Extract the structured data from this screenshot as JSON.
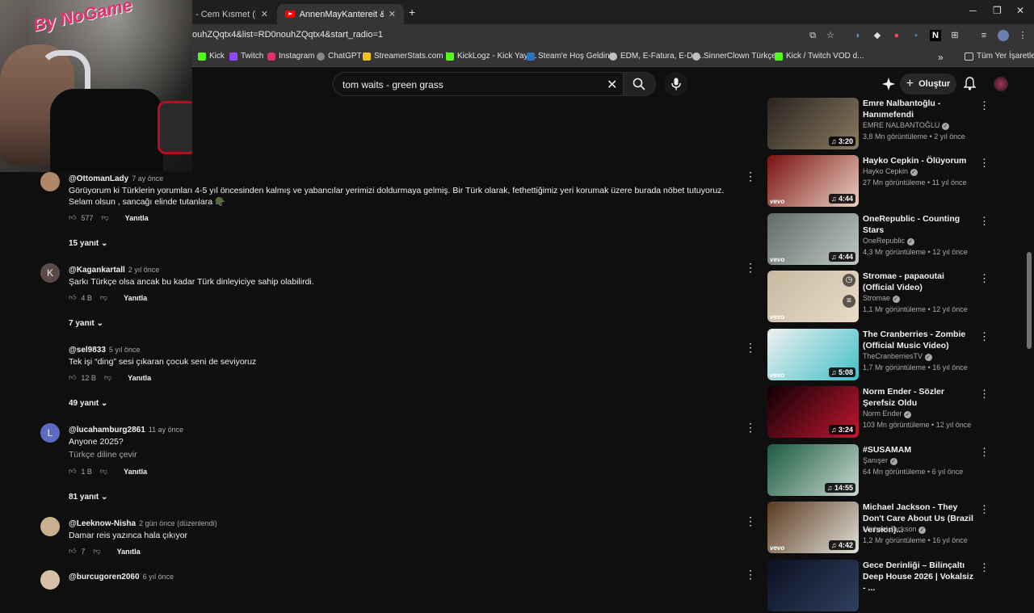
{
  "browser": {
    "tabs": [
      {
        "label": "- Cem Kısmet (Pilli Bebek)"
      },
      {
        "label": "AnnenMayKantereit & K.I.Z. - H"
      }
    ],
    "new_tab": "+",
    "url": "ouhZQqtx4&list=RD0nouhZQqtx4&start_radio=1",
    "bookmarks": [
      "Kick",
      "Twitch",
      "Instagram",
      "ChatGPT",
      "StreamerStats.com |...",
      "KickLogz - Kick Yayı...",
      "Steam'e Hoş Geldiniz",
      "EDM, E-Fatura, E-De...",
      "SinnerClown Türkçe...",
      "Kick / Twitch VOD d..."
    ],
    "bookmarks_more": "»",
    "all_bookmarks": "Tüm Yer İşaretleri",
    "overlay_text": "By NoGame"
  },
  "header": {
    "search_value": "tom waits - green grass",
    "create_label": "Oluştur"
  },
  "comments": [
    {
      "handle": "@OttomanLady",
      "time": "7 ay önce",
      "text": "Görüyorum ki Türklerin yorumları 4-5 yıl öncesinden kalmış ve yabancılar yerimizi doldurmaya gelmiş. Bir Türk olarak, fethettiğimiz yeri korumak üzere burada nöbet tutuyoruz. Selam olsun , sancağı elinde tutanlara 🪖",
      "likes": "577",
      "reply": "Yanıtla",
      "replies": "15 yanıt",
      "avatar_color": "#b08868",
      "avatar_letter": ""
    },
    {
      "handle": "@Kagankartall",
      "time": "2 yıl önce",
      "text": "Şarkı Türkçe olsa ancak bu kadar Türk dinleyiciye sahip olabilirdi.",
      "likes": "4 B",
      "reply": "Yanıtla",
      "replies": "7 yanıt",
      "avatar_color": "#5b4a47",
      "avatar_letter": "K"
    },
    {
      "handle": "@sel9833",
      "time": "5 yıl önce",
      "text": "Tek işi “ding” sesi çıkaran çocuk seni de seviyoruz",
      "likes": "12 B",
      "reply": "Yanıtla",
      "replies": "49 yanıt",
      "avatar_color": "#0f0f0f",
      "avatar_letter": ""
    },
    {
      "handle": "@lucahamburg2861",
      "time": "11 ay önce",
      "text": "Anyone 2025?",
      "translate": "Türkçe diline çevir",
      "likes": "1 B",
      "reply": "Yanıtla",
      "replies": "81 yanıt",
      "avatar_color": "#5c6bc0",
      "avatar_letter": "L"
    },
    {
      "handle": "@Leeknow-Nisha",
      "time": "2 gün önce (düzenlendi)",
      "text": "Damar reis yazınca hala çıkıyor",
      "likes": "7",
      "reply": "Yanıtla",
      "avatar_color": "#c8b090",
      "avatar_letter": ""
    },
    {
      "handle": "@burcugoren2060",
      "time": "6 yıl önce",
      "avatar_color": "#d8c0a8",
      "avatar_letter": ""
    }
  ],
  "sidebar": [
    {
      "title": "Emre Nalbantoğlu - Hanımefendi",
      "channel": "EMRE NALBANTOĞLU",
      "stats": "3,8 Mn görüntüleme • 2 yıl önce",
      "duration": "3:20",
      "vevo": "",
      "c1": "#2a2420",
      "c2": "#8a7a60"
    },
    {
      "title": "Hayko Cepkin - Ölüyorum",
      "channel": "Hayko Cepkin",
      "stats": "27 Mn görüntüleme • 11 yıl önce",
      "duration": "4:44",
      "vevo": "vevo",
      "c1": "#7a1010",
      "c2": "#e8d0c0"
    },
    {
      "title": "OneRepublic - Counting Stars",
      "channel": "OneRepublic",
      "stats": "4,3 Mr görüntüleme • 12 yıl önce",
      "duration": "4:44",
      "vevo": "vevo",
      "c1": "#606a66",
      "c2": "#c0c8c4"
    },
    {
      "title": "Stromae - papaoutai (Official Video)",
      "channel": "Stromae",
      "stats": "1,1 Mr görüntüleme • 12 yıl önce",
      "duration": "",
      "vevo": "vevo",
      "c1": "#c8b8a0",
      "c2": "#e8dcc8"
    },
    {
      "title": "The Cranberries - Zombie (Official Music Video)",
      "channel": "TheCranberriesTV",
      "stats": "1,7 Mr görüntüleme • 16 yıl önce",
      "duration": "5:08",
      "vevo": "vevo",
      "c1": "#f0f0f0",
      "c2": "#40c0c8"
    },
    {
      "title": "Norm Ender - Sözler Şerefsiz Oldu",
      "channel": "Norm Ender",
      "stats": "103 Mn görüntüleme • 12 yıl önce",
      "duration": "3:24",
      "vevo": "",
      "c1": "#100004",
      "c2": "#c01830"
    },
    {
      "title": "#SUSAMAM",
      "channel": "Şanışer",
      "stats": "64 Mn görüntüleme • 6 yıl önce",
      "duration": "14:55",
      "vevo": "",
      "c1": "#1a5a40",
      "c2": "#c8d8d0"
    },
    {
      "title": "Michael Jackson - They Don't Care About Us (Brazil Version)...",
      "channel": "Michael Jackson",
      "stats": "1,2 Mr görüntüleme • 16 yıl önce",
      "duration": "4:42",
      "vevo": "vevo",
      "c1": "#5a3a20",
      "c2": "#e0e0d8"
    },
    {
      "title": "Gece Derinliği – Bilinçaltı Deep House 2026 | Vokalsiz - ...",
      "channel": "",
      "stats": "",
      "duration": "",
      "vevo": "",
      "c1": "#0a1020",
      "c2": "#304060"
    }
  ]
}
